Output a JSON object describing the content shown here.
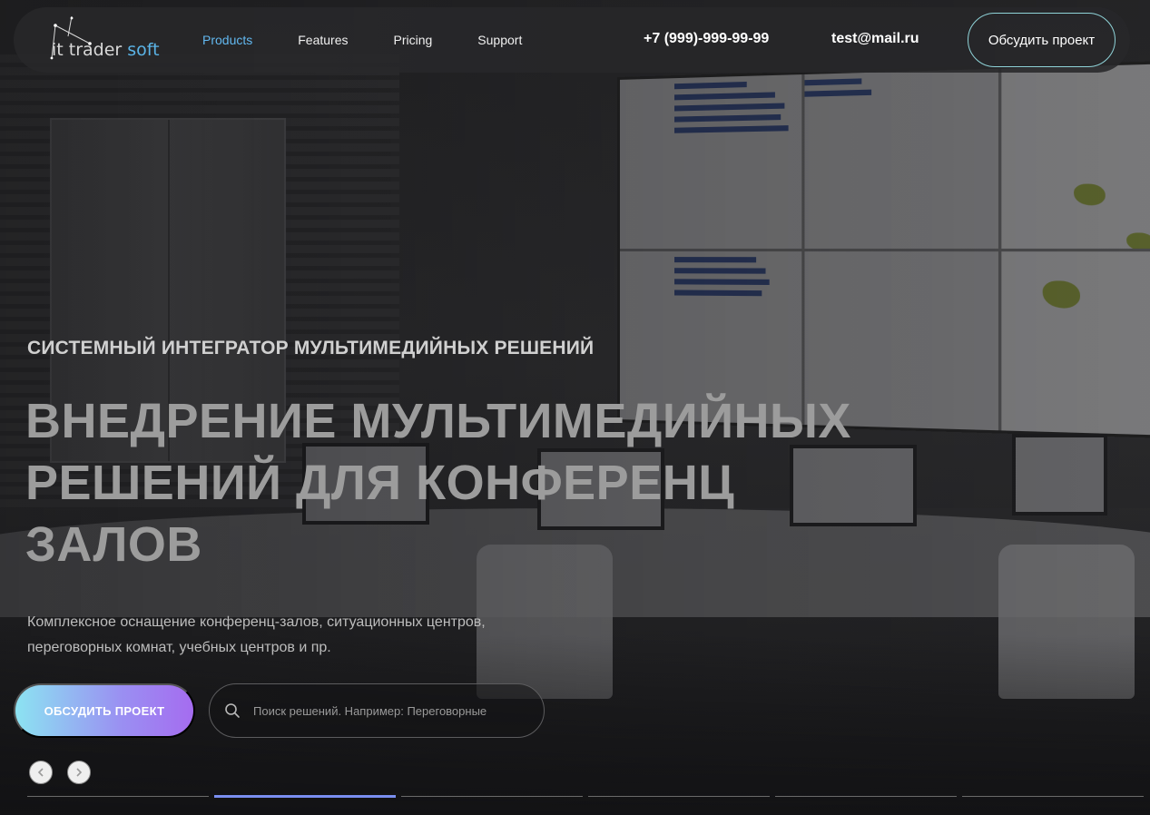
{
  "brand": {
    "prefix": "it trader",
    "suffix": "soft"
  },
  "nav": {
    "items": [
      {
        "label": "Products",
        "active": true
      },
      {
        "label": "Features",
        "active": false
      },
      {
        "label": "Pricing",
        "active": false
      },
      {
        "label": "Support",
        "active": false
      }
    ]
  },
  "contacts": {
    "phone": "+7 (999)-999-99-99",
    "email": "test@mail.ru"
  },
  "header_cta": "Обсудить проект",
  "hero": {
    "eyebrow": "СИСТЕМНЫЙ ИНТЕГРАТОР МУЛЬТИМЕДИЙНЫХ РЕШЕНИЙ",
    "headline": "ВНЕДРЕНИЕ МУЛЬТИМЕДИЙНЫХ РЕШЕНИЙ ДЛЯ КОНФЕРЕНЦ ЗАЛОВ",
    "subtitle": "Комплексное оснащение конференц-залов, ситуационных центров, переговорных комнат, учебных центров и пр."
  },
  "actions": {
    "cta_label": "ОБСУДИТЬ ПРОЕКТ",
    "search_placeholder": "Поиск решений. Например: Переговорные"
  },
  "slider": {
    "total": 6,
    "current": 1
  },
  "colors": {
    "accent_blue": "#62b8f0",
    "cta_gradient_start": "#8ce3f2",
    "cta_gradient_end": "#a56cf0",
    "header_button_border": "#8fd3d8"
  },
  "icons": {
    "logo": "constellation-logo-icon",
    "search": "search-icon",
    "prev": "chevron-left-icon",
    "next": "chevron-right-icon"
  }
}
